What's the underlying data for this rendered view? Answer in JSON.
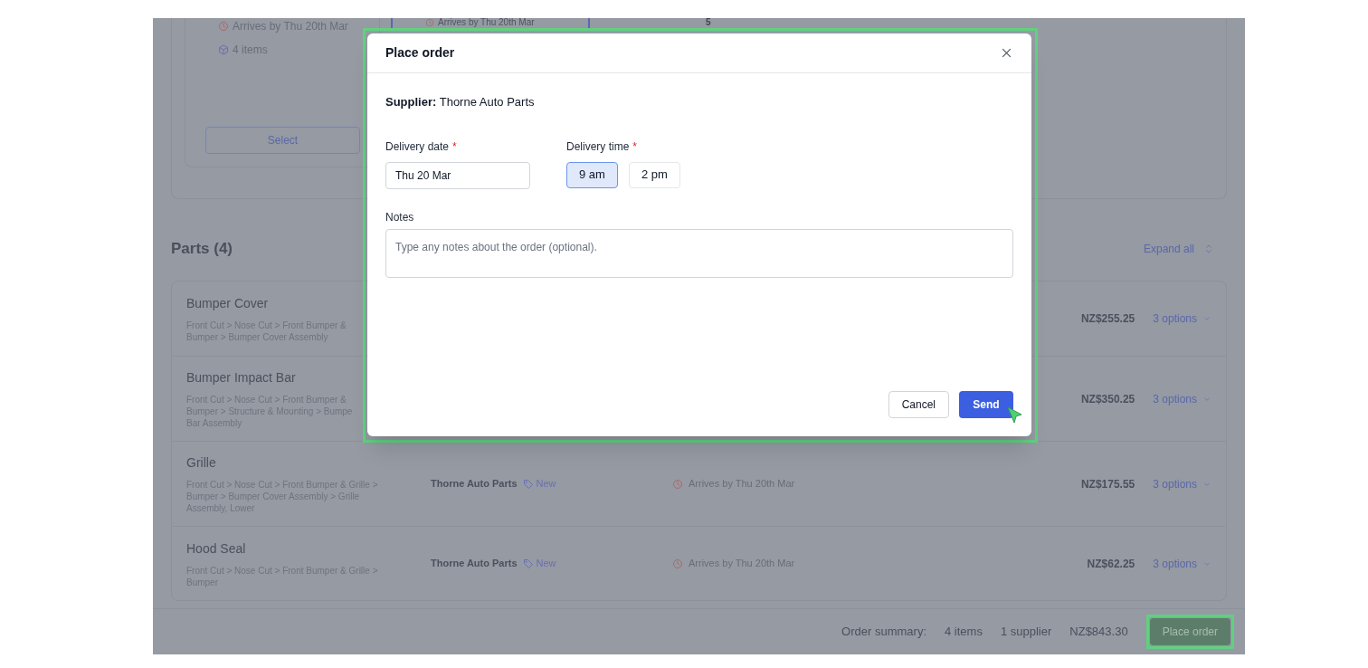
{
  "top_section": {
    "left_card": {
      "arrival": "Arrives by Thu 20th Mar",
      "items": "4 items",
      "select_button": "Select"
    },
    "second_column": {
      "arrival": "Arrives by Thu 20th Mar"
    },
    "quantity": "5"
  },
  "parts": {
    "title": "Parts (4)",
    "expand_all": "Expand all",
    "rows": [
      {
        "name": "Bumper Cover",
        "path": [
          "Front Cut > Nose Cut > Front Bumper &",
          "Bumper > Bumper Cover Assembly"
        ],
        "price": "NZ$255.25",
        "options": "3 options"
      },
      {
        "name": "Bumper Impact Bar",
        "path": [
          "Front Cut > Nose Cut > Front Bumper &",
          "Bumper > Structure & Mounting > Bumpe",
          "Bar Assembly"
        ],
        "price": "NZ$350.25",
        "options": "3 options"
      },
      {
        "name": "Grille",
        "path": [
          "Front Cut > Nose Cut > Front Bumper & Grille >",
          "Bumper > Bumper Cover Assembly > Grille",
          "Assembly, Lower"
        ],
        "supplier": "Thorne Auto Parts",
        "tag": "New",
        "arrival": "Arrives by Thu 20th Mar",
        "price": "NZ$175.55",
        "options": "3 options"
      },
      {
        "name": "Hood Seal",
        "path": [
          "Front Cut > Nose Cut > Front Bumper & Grille >",
          "Bumper"
        ],
        "supplier": "Thorne Auto Parts",
        "tag": "New",
        "arrival": "Arrives by Thu 20th Mar",
        "price": "NZ$62.25",
        "options": "3 options"
      }
    ]
  },
  "footer": {
    "label": "Order summary:",
    "items": "4 items",
    "suppliers": "1 supplier",
    "total": "NZ$843.30",
    "button": "Place order"
  },
  "modal": {
    "title": "Place order",
    "supplier": "**Supplier:** Thorne Auto Parts",
    "date": {
      "label": "Delivery date",
      "marker": "*",
      "value": "Thu 20 Mar"
    },
    "time": {
      "label": "Delivery time",
      "marker": "*",
      "options": [
        {
          "label": "9 am",
          "selected": true
        },
        {
          "label": "2 pm",
          "selected": false
        }
      ]
    },
    "notes": {
      "label": "Notes",
      "placeholder": "Type any notes about the order (optional)."
    },
    "cancel": "Cancel",
    "send": "Send"
  }
}
